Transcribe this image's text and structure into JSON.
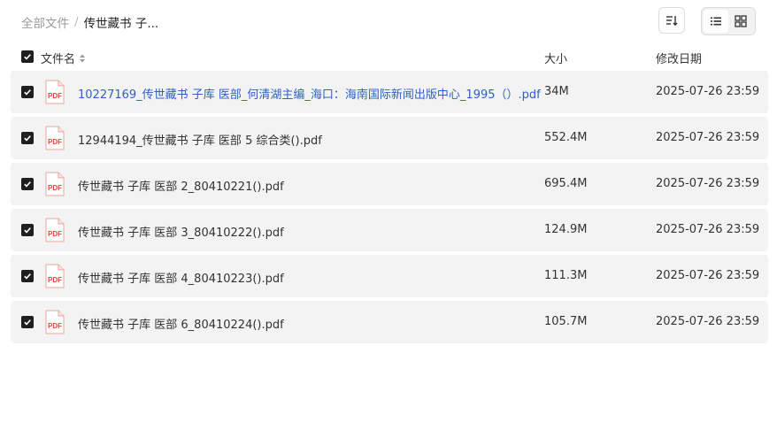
{
  "breadcrumb": {
    "root": "全部文件",
    "separator": "/",
    "current": "传世藏书 子..."
  },
  "toolbar": {
    "sort_icon": "sort-descending-icon",
    "view_list_icon": "list-view-icon",
    "view_grid_icon": "grid-view-icon",
    "active_view": "list"
  },
  "columns": {
    "name": "文件名",
    "size": "大小",
    "date": "修改日期"
  },
  "select_all_checked": true,
  "file_icon_label": "PDF",
  "colors": {
    "link": "#2f5fc9",
    "row_bg": "#f3f3f3",
    "pdf_red": "#e2463b"
  },
  "files": [
    {
      "name": "10227169_传世藏书 子库 医部_何清湖主编_海口：海南国际新闻出版中心_1995（）.pdf",
      "size": "34M",
      "date": "2025-07-26 23:59",
      "checked": true,
      "highlighted": true
    },
    {
      "name": "12944194_传世藏书 子库 医部 5 综合类().pdf",
      "size": "552.4M",
      "date": "2025-07-26 23:59",
      "checked": true,
      "highlighted": false
    },
    {
      "name": "传世藏书 子库 医部 2_80410221().pdf",
      "size": "695.4M",
      "date": "2025-07-26 23:59",
      "checked": true,
      "highlighted": false
    },
    {
      "name": "传世藏书 子库 医部 3_80410222().pdf",
      "size": "124.9M",
      "date": "2025-07-26 23:59",
      "checked": true,
      "highlighted": false
    },
    {
      "name": "传世藏书 子库 医部 4_80410223().pdf",
      "size": "111.3M",
      "date": "2025-07-26 23:59",
      "checked": true,
      "highlighted": false
    },
    {
      "name": "传世藏书 子库 医部 6_80410224().pdf",
      "size": "105.7M",
      "date": "2025-07-26 23:59",
      "checked": true,
      "highlighted": false
    }
  ]
}
